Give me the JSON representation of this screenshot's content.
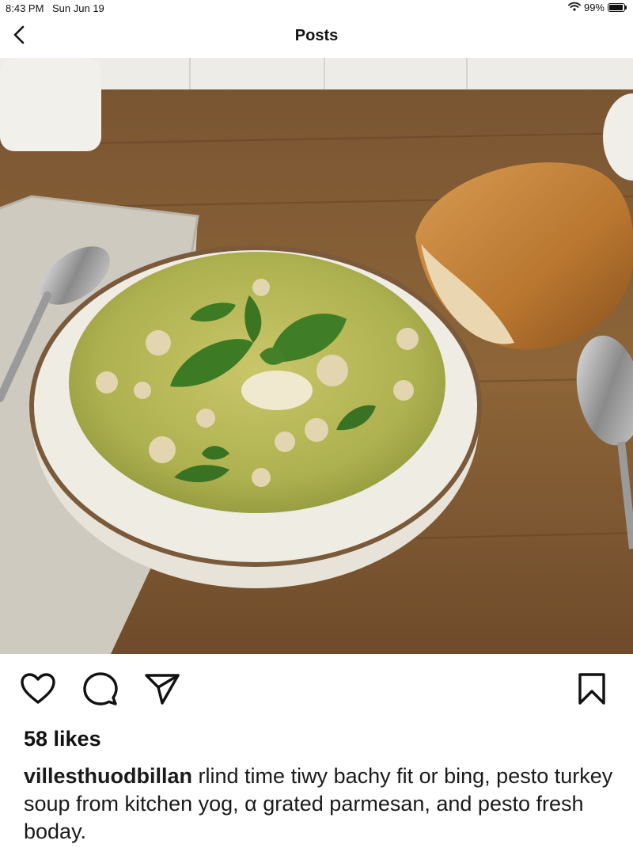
{
  "status_bar": {
    "time": "8:43 PM",
    "date": "Sun Jun 19",
    "battery_text": "99%",
    "battery_level": 0.99,
    "icons": [
      "wifi-icon",
      "battery-icon"
    ]
  },
  "nav": {
    "title": "Posts",
    "back_icon": "chevron-left-icon"
  },
  "post": {
    "image_subject": "bowl of pesto turkey soup with basil and parmesan, bread loaf, spoons, linen napkin on wooden table",
    "actions": [
      "heart-icon",
      "comment-icon",
      "share-icon",
      "bookmark-icon"
    ],
    "likes": "58 likes",
    "username": "villesthuodbillan",
    "caption": " rlind time tiwy bachy fit or bing, pesto turkey soup from kitchen yog, α grated parmesan, and pesto fresh boday."
  },
  "colors": {
    "text": "#111111",
    "background": "#ffffff"
  }
}
